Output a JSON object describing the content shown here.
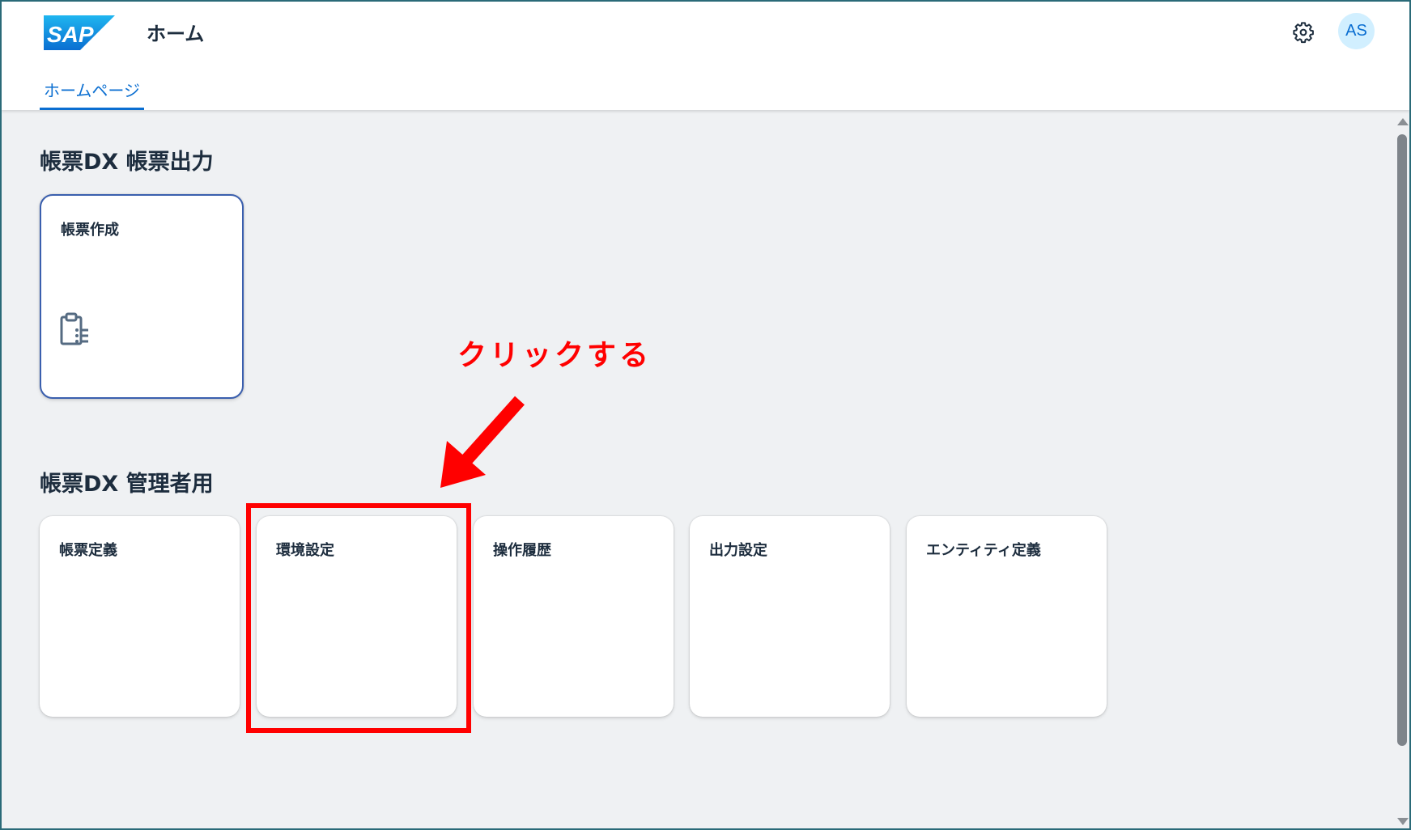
{
  "header": {
    "logo_text": "SAP",
    "title": "ホーム",
    "avatar_initials": "AS",
    "brand_color": "#0a6ed1"
  },
  "tabs": [
    {
      "label": "ホームページ",
      "selected": true
    }
  ],
  "sections": [
    {
      "title": "帳票DX 帳票出力",
      "tiles": [
        {
          "title": "帳票作成",
          "icon": "clipboard-list-icon"
        }
      ]
    },
    {
      "title": "帳票DX 管理者用",
      "tiles": [
        {
          "title": "帳票定義"
        },
        {
          "title": "環境設定"
        },
        {
          "title": "操作履歴"
        },
        {
          "title": "出力設定"
        },
        {
          "title": "エンティティ定義"
        }
      ]
    }
  ],
  "annotation": {
    "text": "クリックする",
    "color": "#ff0000"
  }
}
